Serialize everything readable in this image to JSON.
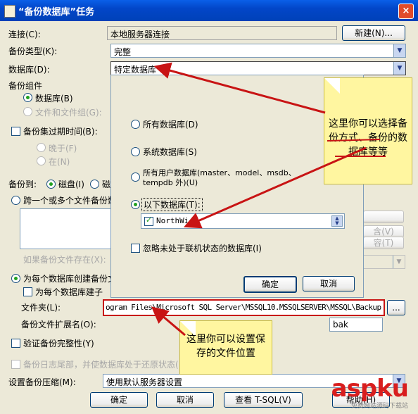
{
  "window": {
    "title": "“备份数据库”任务",
    "close": "×"
  },
  "form": {
    "connection_label": "连接(C):",
    "connection_value": "本地服务器连接",
    "new_btn": "新建(N)...",
    "backup_type_label": "备份类型(K):",
    "backup_type_value": "完整",
    "database_label": "数据库(D):",
    "database_value": "特定数据库",
    "component_label": "备份组件",
    "comp_db": "数据库(B)",
    "comp_files": "文件和文件组(G):",
    "expire_label": "备份集过期时间(B):",
    "after": "晚于(F)",
    "on": "在(N)",
    "backup_to": "备份到:",
    "disk": "磁盘(I)",
    "tape": "磁",
    "span_files": "跨一个或多个文件备份数",
    "if_exists": "如果备份文件存在(X):",
    "per_db": "为每个数据库创建备份文",
    "per_db_sub": "为每个数据库建子",
    "folder_label": "文件夹(L):",
    "folder_value": "ogram Files\\Microsoft SQL Server\\MSSQL10.MSSQLSERVER\\MSSQL\\Backup",
    "browse": "...",
    "ext_label": "备份文件扩展名(O):",
    "ext_value": "bak",
    "verify": "验证备份完整性(Y)",
    "tail_log": "备份日志尾部，并使数据库处于还原状态(",
    "compress_label": "设置备份压缩(M):",
    "compress_value": "使用默认服务器设置",
    "ok": "确定",
    "cancel": "取消",
    "view_tsql": "查看 T-SQL(V)",
    "help": "帮助(H)"
  },
  "right_stub": {
    "a": "",
    "b": "含(V)",
    "c": "容(T)"
  },
  "popup": {
    "all_db": "所有数据库(D)",
    "system_db": "系统数据库(S)",
    "user_db": "所有用户数据库(master、model、msdb、tempdb 外)(U)",
    "these_db": "以下数据库(T):",
    "db_item": "NorthWi",
    "ignore": "忽略未处于联机状态的数据库(I)",
    "ok": "确定",
    "cancel": "取消"
  },
  "notes": {
    "top": "这里你可以选择备份方式、备份的数据库等等",
    "bottom": "这里你可以设置保存的文件位置"
  },
  "watermark": {
    "brand": "aspku",
    "sub": "免费网站源码下载站"
  }
}
